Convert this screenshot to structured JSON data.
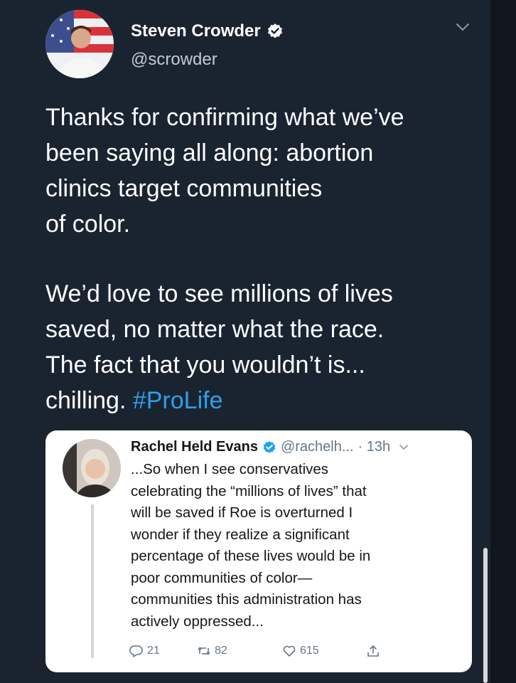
{
  "author": {
    "name": "Steven Crowder",
    "handle": "@scrowder"
  },
  "tweet": {
    "paragraph1": [
      "Thanks for confirming what we’ve",
      "been saying all along: abortion",
      "clinics target communities",
      "of color."
    ],
    "paragraph2": [
      "We’d love to see millions of lives",
      "saved, no matter what the race.",
      "The fact that you wouldn’t is...",
      "chilling."
    ],
    "hashtag": "#ProLife"
  },
  "quoted": {
    "name": "Rachel Held Evans",
    "handle": "@rachelh...",
    "time": "· 13h",
    "lines": [
      "...So when I see conservatives",
      "celebrating the “millions of lives” that",
      "will be saved if Roe is overturned I",
      "wonder if they realize a significant",
      "percentage of these lives would be in",
      "poor communities of color—",
      "communities this administration has",
      "actively oppressed..."
    ],
    "replies": "21",
    "retweets": "82",
    "likes": "615"
  },
  "icons": [
    "verified-icon",
    "chevron-down-icon",
    "reply-icon",
    "retweet-icon",
    "like-icon",
    "share-icon"
  ],
  "colors": {
    "background": "#1a2431",
    "hashtag": "#2f9fe8",
    "verified": "#1da1f2",
    "quote_bg": "#ffffff"
  }
}
